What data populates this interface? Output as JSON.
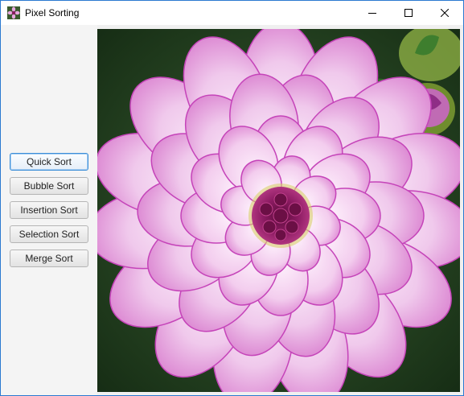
{
  "window": {
    "title": "Pixel Sorting",
    "app_icon": "flower-icon",
    "controls": [
      "minimize-icon",
      "maximize-icon",
      "close-icon"
    ]
  },
  "sidebar": {
    "buttons": [
      {
        "label": "Quick Sort",
        "focused": true
      },
      {
        "label": "Bubble Sort",
        "focused": false
      },
      {
        "label": "Insertion Sort",
        "focused": false
      },
      {
        "label": "Selection Sort",
        "focused": false
      },
      {
        "label": "Merge Sort",
        "focused": false
      }
    ]
  },
  "image": {
    "subject": "pink-white dahlia flower",
    "colors": {
      "petal": "#f1c6ec",
      "petal_edge": "#c23fb8",
      "center": "#7a1452",
      "leaf": "#2d5a26",
      "background": "#1e3b1b"
    }
  }
}
